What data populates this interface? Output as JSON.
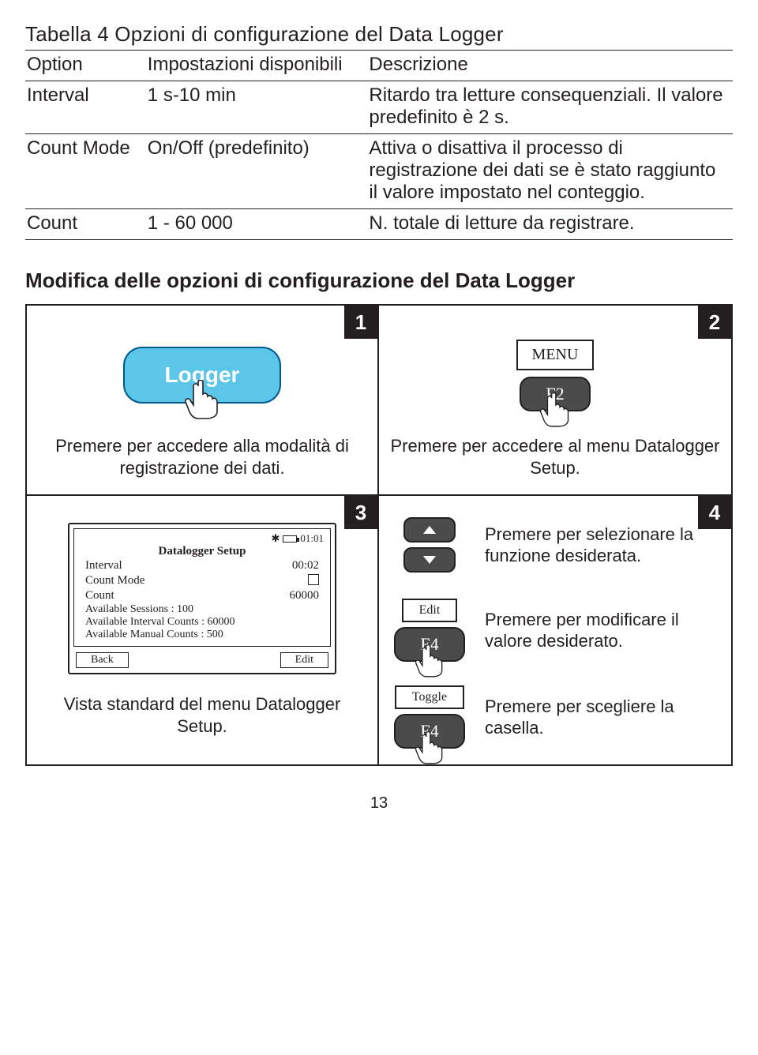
{
  "table": {
    "title": "Tabella 4 Opzioni di configurazione del Data Logger",
    "headers": {
      "option": "Option",
      "settings": "Impostazioni disponibili",
      "desc": "Descrizione"
    },
    "rows": [
      {
        "option": "Interval",
        "settings": "1 s-10 min",
        "desc": "Ritardo tra letture consequenziali. Il valore predefinito è 2 s."
      },
      {
        "option": "Count Mode",
        "settings": "On/Off (predefinito)",
        "desc": "Attiva o disattiva il processo di registrazione dei dati se è stato raggiunto il valore impostato nel conteggio."
      },
      {
        "option": "Count",
        "settings": "1 - 60 000",
        "desc": "N. totale di letture da registrare."
      }
    ]
  },
  "section_title": "Modifica delle opzioni di configurazione del Data Logger",
  "steps": {
    "s1": {
      "num": "1",
      "logger_label": "Logger",
      "caption": "Premere per accedere alla modalità di registrazione dei dati."
    },
    "s2": {
      "num": "2",
      "menu_label": "MENU",
      "fkey": "F2",
      "caption": "Premere per accedere al menu Datalogger Setup."
    },
    "s3": {
      "num": "3",
      "screen": {
        "time": "01:01",
        "title": "Datalogger Setup",
        "interval_label": "Interval",
        "interval_value": "00:02",
        "countmode_label": "Count Mode",
        "count_label": "Count",
        "count_value": "60000",
        "avail_sessions": "Available Sessions : 100",
        "avail_interval": "Available Interval Counts :  60000",
        "avail_manual": "Available Manual Counts : 500",
        "back": "Back",
        "edit": "Edit"
      },
      "caption": "Vista standard del menu Datalogger Setup."
    },
    "s4": {
      "num": "4",
      "r1": {
        "text": "Premere per selezionare la funzione desiderata."
      },
      "r2": {
        "soft": "Edit",
        "fkey": "F4",
        "text": "Premere per modificare il valore desiderato."
      },
      "r3": {
        "soft": "Toggle",
        "fkey": "F4",
        "text": "Premere per scegliere la casella."
      }
    }
  },
  "page_number": "13"
}
